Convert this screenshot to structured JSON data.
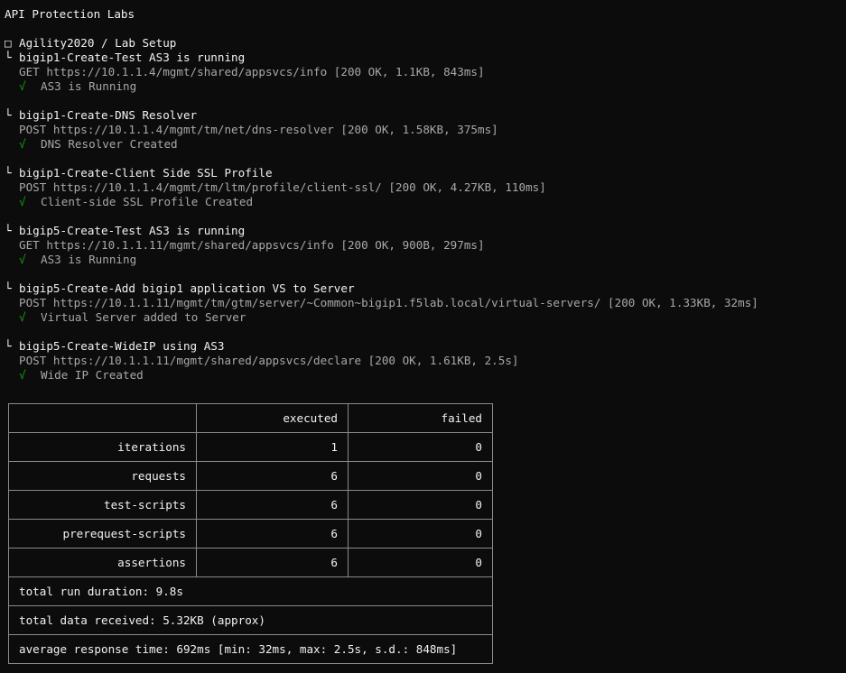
{
  "app": {
    "title": "API Protection Labs"
  },
  "collection": {
    "icon": "box-icon",
    "icon_glyph": "□",
    "name": "Agility2020 / Lab Setup"
  },
  "branch_glyph": "└",
  "check_glyph": "√",
  "requests": [
    {
      "name": "bigip1-Create-Test AS3 is running",
      "request_line": "GET https://10.1.1.4/mgmt/shared/appsvcs/info [200 OK, 1.1KB, 843ms]",
      "assertion": "AS3 is Running"
    },
    {
      "name": "bigip1-Create-DNS Resolver",
      "request_line": "POST https://10.1.1.4/mgmt/tm/net/dns-resolver [200 OK, 1.58KB, 375ms]",
      "assertion": "DNS Resolver Created"
    },
    {
      "name": "bigip1-Create-Client Side SSL Profile",
      "request_line": "POST https://10.1.1.4/mgmt/tm/ltm/profile/client-ssl/ [200 OK, 4.27KB, 110ms]",
      "assertion": "Client-side SSL Profile Created"
    },
    {
      "name": "bigip5-Create-Test AS3 is running",
      "request_line": "GET https://10.1.1.11/mgmt/shared/appsvcs/info [200 OK, 900B, 297ms]",
      "assertion": "AS3 is Running"
    },
    {
      "name": "bigip5-Create-Add bigip1 application VS to Server",
      "request_line": "POST https://10.1.1.11/mgmt/tm/gtm/server/~Common~bigip1.f5lab.local/virtual-servers/ [200 OK, 1.33KB, 32ms]",
      "assertion": "Virtual Server added to Server"
    },
    {
      "name": "bigip5-Create-WideIP using AS3",
      "request_line": "POST https://10.1.1.11/mgmt/shared/appsvcs/declare [200 OK, 1.61KB, 2.5s]",
      "assertion": "Wide IP Created"
    }
  ],
  "summary": {
    "headers": {
      "executed": "executed",
      "failed": "failed"
    },
    "rows": [
      {
        "label": "iterations",
        "executed": "1",
        "failed": "0"
      },
      {
        "label": "requests",
        "executed": "6",
        "failed": "0"
      },
      {
        "label": "test-scripts",
        "executed": "6",
        "failed": "0"
      },
      {
        "label": "prerequest-scripts",
        "executed": "6",
        "failed": "0"
      },
      {
        "label": "assertions",
        "executed": "6",
        "failed": "0"
      }
    ],
    "total_run_duration": "total run duration: 9.8s",
    "total_data_received": "total data received: 5.32KB (approx)",
    "average_response_time": "average response time: 692ms [min: 32ms, max: 2.5s, s.d.: 848ms]"
  },
  "colors": {
    "background": "#0c0c0c",
    "text": "#cccccc",
    "bright": "#f2f2f2",
    "success": "#13a10e",
    "border": "#8a8a8a"
  }
}
